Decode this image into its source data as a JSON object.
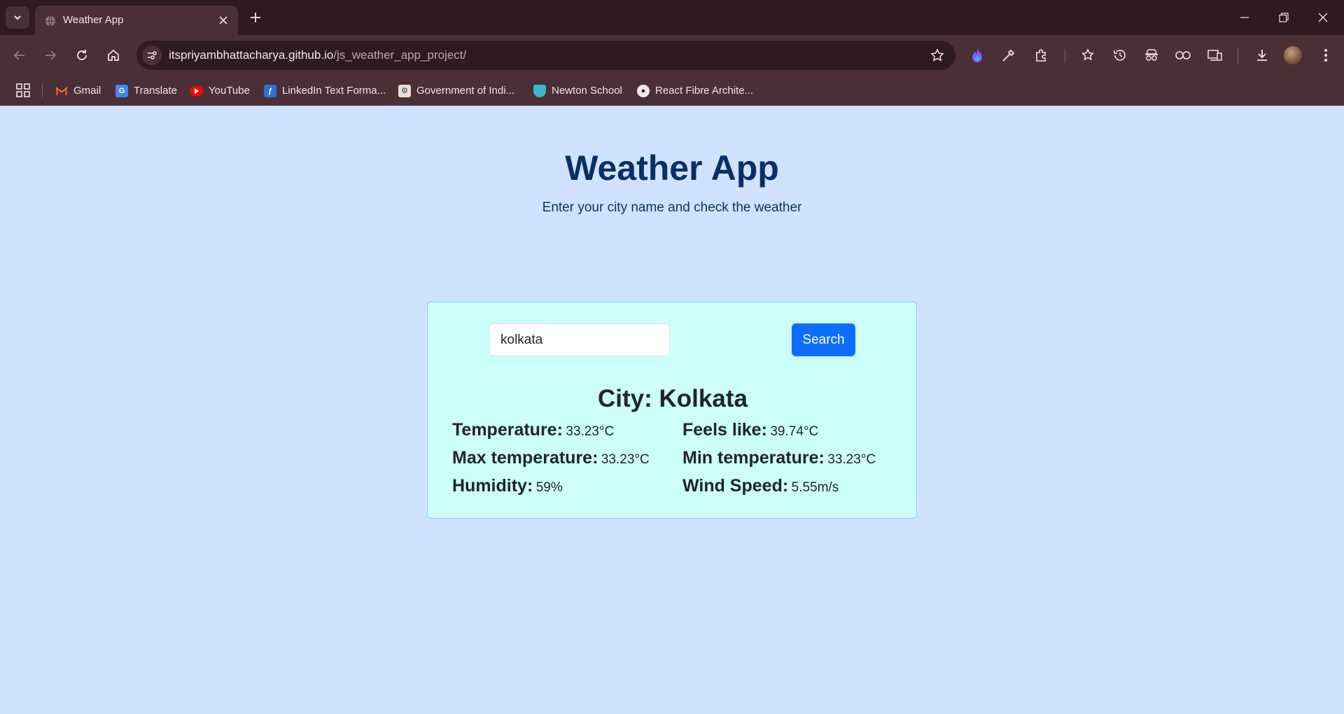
{
  "browser": {
    "tab": {
      "title": "Weather App"
    },
    "address": {
      "host": "itspriyambhattacharya.github.io",
      "path": "/js_weather_app_project/"
    },
    "bookmarks": [
      {
        "label": "Gmail"
      },
      {
        "label": "Translate"
      },
      {
        "label": "YouTube"
      },
      {
        "label": "LinkedIn Text Forma..."
      },
      {
        "label": "Government of Indi..."
      },
      {
        "label": "Newton School"
      },
      {
        "label": "React  Fibre Archite..."
      }
    ]
  },
  "app": {
    "title": "Weather App",
    "subtitle": "Enter your city name and check the weather",
    "search": {
      "value": "kolkata",
      "button_label": "Search"
    },
    "city": "City: Kolkata",
    "stats": {
      "temperature": {
        "label": "Temperature:",
        "value": "33.23°C"
      },
      "feels_like": {
        "label": "Feels like:",
        "value": "39.74°C"
      },
      "max_temp": {
        "label": "Max temperature:",
        "value": "33.23°C"
      },
      "min_temp": {
        "label": "Min temperature:",
        "value": "33.23°C"
      },
      "humidity": {
        "label": "Humidity:",
        "value": "59%"
      },
      "wind_speed": {
        "label": "Wind Speed:",
        "value": "5.55m/s"
      }
    }
  },
  "colors": {
    "page_bg": "#cfe2ff",
    "card_bg": "#ccfff9",
    "title": "#0a2f66",
    "button": "#0d6efd",
    "chrome_dark": "#2f1a20",
    "chrome": "#4b2f37"
  },
  "icons": [
    "tab-search-icon",
    "globe-icon",
    "close-icon",
    "plus-icon",
    "minimize-icon",
    "restore-icon",
    "back-icon",
    "forward-icon",
    "reload-icon",
    "home-icon",
    "site-info-icon",
    "star-icon",
    "extension-icon",
    "history-icon",
    "download-icon",
    "apps-icon"
  ]
}
